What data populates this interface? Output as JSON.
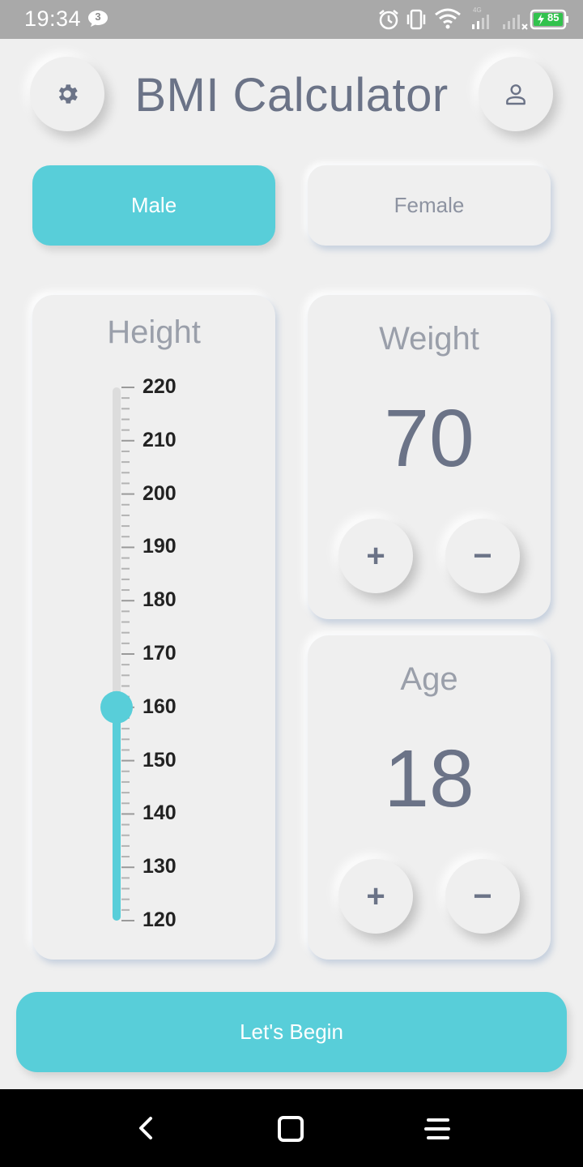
{
  "status_bar": {
    "time": "19:34",
    "notification_count": "3",
    "battery_level": "85",
    "icons": [
      "alarm-icon",
      "vibrate-icon",
      "wifi-icon",
      "signal-4g-icon",
      "signal-icon",
      "battery-charging-icon"
    ]
  },
  "header": {
    "title": "BMI Calculator",
    "settings_icon": "gear-icon",
    "profile_icon": "user-icon"
  },
  "gender": {
    "male_label": "Male",
    "female_label": "Female",
    "selected": "Male"
  },
  "height": {
    "label": "Height",
    "min": 120,
    "max": 220,
    "value": 160,
    "tick_labels": [
      "220",
      "210",
      "200",
      "190",
      "180",
      "170",
      "160",
      "150",
      "140",
      "130",
      "120"
    ]
  },
  "weight": {
    "label": "Weight",
    "value": "70",
    "plus_label": "+",
    "minus_label": "−"
  },
  "age": {
    "label": "Age",
    "value": "18",
    "plus_label": "+",
    "minus_label": "−"
  },
  "actions": {
    "begin_label": "Let's Begin"
  },
  "colors": {
    "accent": "#58ced9",
    "text_primary": "#6b7387",
    "text_muted": "#9a9faa",
    "background": "#efefef"
  }
}
